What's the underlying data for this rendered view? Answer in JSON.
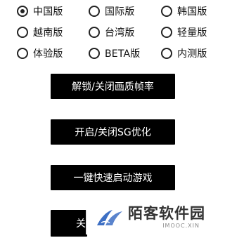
{
  "versions": {
    "selected": "中国版",
    "options": [
      "中国版",
      "国际版",
      "韩国版",
      "越南版",
      "台湾版",
      "轻量版",
      "体验版",
      "BETA版",
      "内测版"
    ]
  },
  "buttons": {
    "unlock_quality": "解锁/关闭画质帧率",
    "sg_optimize": "开启/关闭SG优化",
    "quick_launch": "一键快速启动游戏",
    "partial": "关"
  },
  "watermark": {
    "title": "陌客软件园",
    "subtitle": "IMOOC.XIN",
    "logo_icon": "wing-logo-icon",
    "logo_color": "#3d6fc4"
  }
}
